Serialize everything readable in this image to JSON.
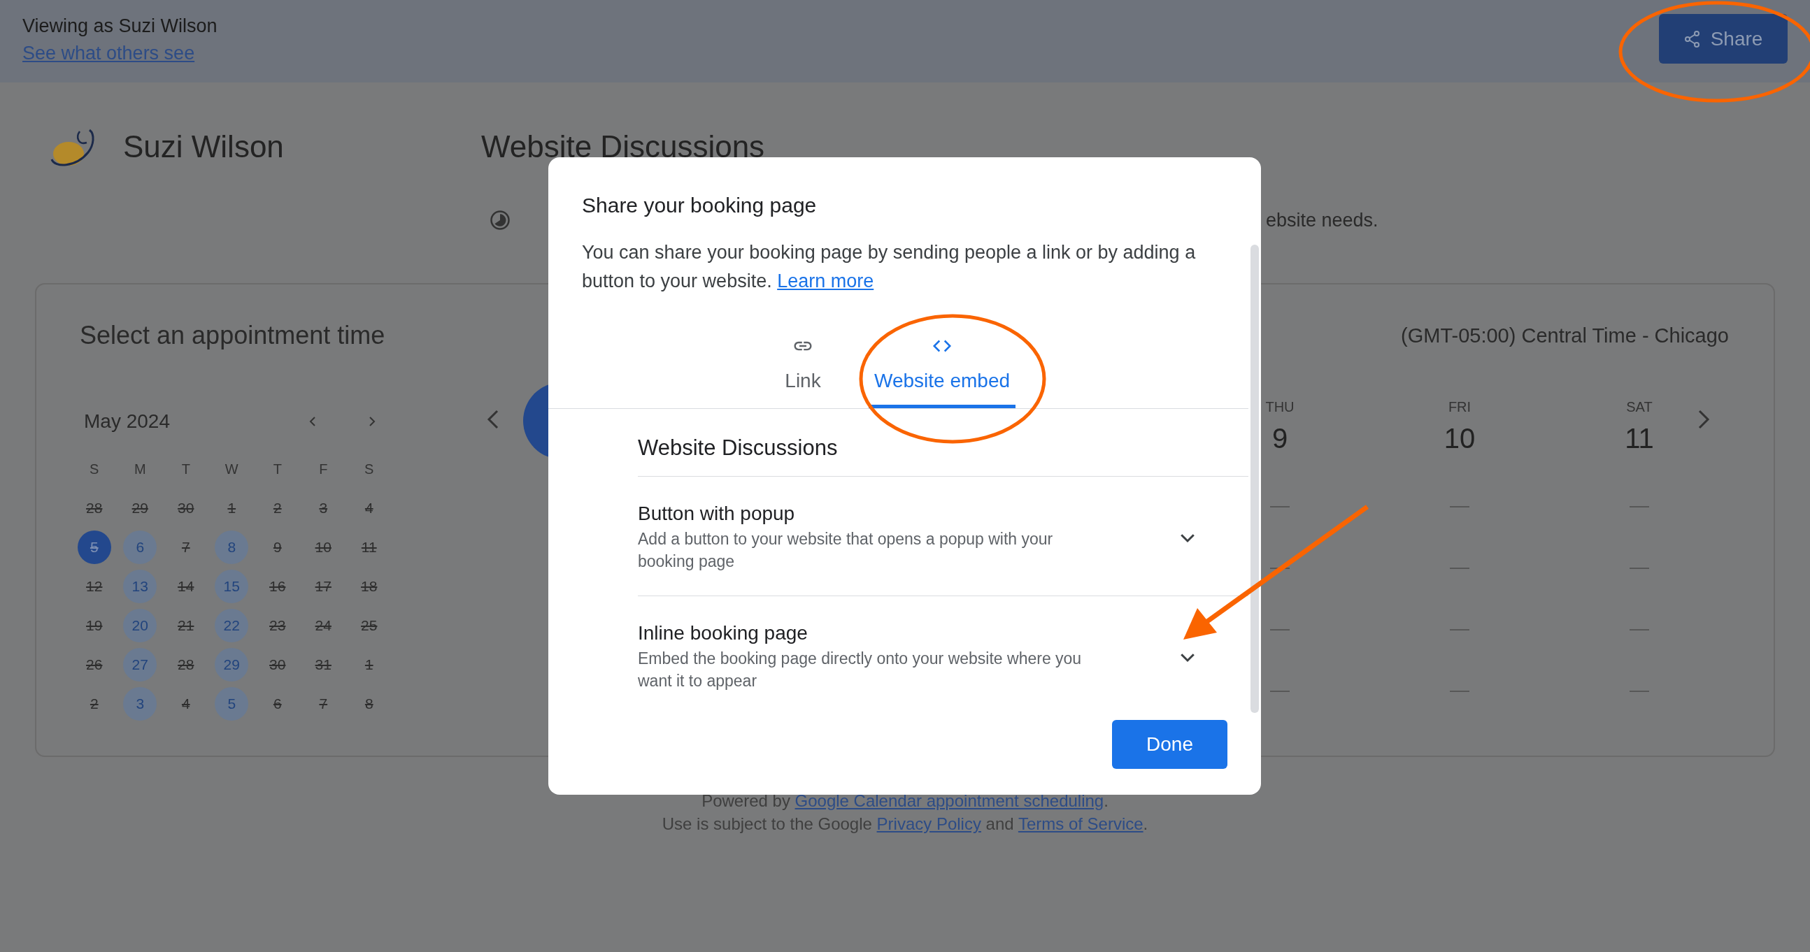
{
  "banner": {
    "viewing_as": "Viewing as Suzi Wilson",
    "link": "See what others see",
    "share_button": "Share"
  },
  "profile": {
    "name": "Suzi Wilson"
  },
  "page_title": "Website Discussions",
  "description": "ebsite needs.",
  "card": {
    "title": "Select an appointment time",
    "timezone": "(GMT-05:00) Central Time - Chicago",
    "mini_calendar": {
      "month": "May 2024",
      "weekdays": [
        "S",
        "M",
        "T",
        "W",
        "T",
        "F",
        "S"
      ],
      "weeks": [
        [
          {
            "day": "28",
            "available": false,
            "selected": false
          },
          {
            "day": "29",
            "available": false,
            "selected": false
          },
          {
            "day": "30",
            "available": false,
            "selected": false
          },
          {
            "day": "1",
            "available": false,
            "selected": false
          },
          {
            "day": "2",
            "available": false,
            "selected": false
          },
          {
            "day": "3",
            "available": false,
            "selected": false
          },
          {
            "day": "4",
            "available": false,
            "selected": false
          }
        ],
        [
          {
            "day": "5",
            "available": false,
            "selected": true
          },
          {
            "day": "6",
            "available": true,
            "selected": false
          },
          {
            "day": "7",
            "available": false,
            "selected": false
          },
          {
            "day": "8",
            "available": true,
            "selected": false
          },
          {
            "day": "9",
            "available": false,
            "selected": false
          },
          {
            "day": "10",
            "available": false,
            "selected": false
          },
          {
            "day": "11",
            "available": false,
            "selected": false
          }
        ],
        [
          {
            "day": "12",
            "available": false,
            "selected": false
          },
          {
            "day": "13",
            "available": true,
            "selected": false
          },
          {
            "day": "14",
            "available": false,
            "selected": false
          },
          {
            "day": "15",
            "available": true,
            "selected": false
          },
          {
            "day": "16",
            "available": false,
            "selected": false
          },
          {
            "day": "17",
            "available": false,
            "selected": false
          },
          {
            "day": "18",
            "available": false,
            "selected": false
          }
        ],
        [
          {
            "day": "19",
            "available": false,
            "selected": false
          },
          {
            "day": "20",
            "available": true,
            "selected": false
          },
          {
            "day": "21",
            "available": false,
            "selected": false
          },
          {
            "day": "22",
            "available": true,
            "selected": false
          },
          {
            "day": "23",
            "available": false,
            "selected": false
          },
          {
            "day": "24",
            "available": false,
            "selected": false
          },
          {
            "day": "25",
            "available": false,
            "selected": false
          }
        ],
        [
          {
            "day": "26",
            "available": false,
            "selected": false
          },
          {
            "day": "27",
            "available": true,
            "selected": false
          },
          {
            "day": "28",
            "available": false,
            "selected": false
          },
          {
            "day": "29",
            "available": true,
            "selected": false
          },
          {
            "day": "30",
            "available": false,
            "selected": false
          },
          {
            "day": "31",
            "available": false,
            "selected": false
          },
          {
            "day": "1",
            "available": false,
            "selected": false
          }
        ],
        [
          {
            "day": "2",
            "available": false,
            "selected": false
          },
          {
            "day": "3",
            "available": true,
            "selected": false
          },
          {
            "day": "4",
            "available": false,
            "selected": false
          },
          {
            "day": "5",
            "available": true,
            "selected": false
          },
          {
            "day": "6",
            "available": false,
            "selected": false
          },
          {
            "day": "7",
            "available": false,
            "selected": false
          },
          {
            "day": "8",
            "available": false,
            "selected": false
          }
        ]
      ]
    },
    "week_view": {
      "days": [
        {
          "weekday": "THU",
          "date": "9",
          "slots": [
            "—",
            "—",
            "—",
            "—"
          ]
        },
        {
          "weekday": "FRI",
          "date": "10",
          "slots": [
            "—",
            "—",
            "—",
            "—"
          ]
        },
        {
          "weekday": "SAT",
          "date": "11",
          "slots": [
            "—",
            "—",
            "—",
            "—"
          ]
        }
      ]
    }
  },
  "dialog": {
    "title": "Share your booking page",
    "text": [
      {
        "text": "You can share your booking page by sending people a link or by adding a button to your website. ",
        "kind": "text"
      },
      {
        "text": "Learn more",
        "kind": "link"
      }
    ],
    "tabs": [
      {
        "kind": "link",
        "label": "Link",
        "selected": false
      },
      {
        "kind": "embed",
        "label": "Website embed",
        "selected": true
      }
    ],
    "section_title": "Website Discussions",
    "options": [
      {
        "title": "Button with popup",
        "description": "Add a button to your website that opens a popup with your booking page",
        "expanded": false
      },
      {
        "title": "Inline booking page",
        "description": "Embed the booking page directly onto your website where you want it to appear",
        "expanded": false
      }
    ],
    "done_button": "Done"
  },
  "footer": {
    "lines": [
      [
        {
          "text": "Powered by ",
          "kind": "text"
        },
        {
          "text": "Google Calendar appointment scheduling",
          "kind": "link"
        },
        {
          "text": ".",
          "kind": "text"
        }
      ],
      [
        {
          "text": "Use is subject to the Google ",
          "kind": "text"
        },
        {
          "text": "Privacy Policy",
          "kind": "link"
        },
        {
          "text": " and ",
          "kind": "text"
        },
        {
          "text": "Terms of Service",
          "kind": "link"
        },
        {
          "text": ".",
          "kind": "text"
        }
      ]
    ]
  }
}
